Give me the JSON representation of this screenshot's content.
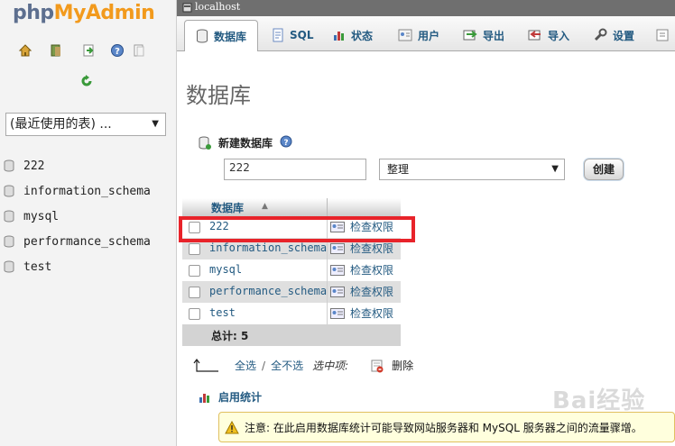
{
  "logo": {
    "part1": "php",
    "part2": "MyAdmin"
  },
  "left": {
    "recent_select": "(最近使用的表) ...",
    "databases": [
      "222",
      "information_schema",
      "mysql",
      "performance_schema",
      "test"
    ]
  },
  "topbar": {
    "host": "localhost"
  },
  "tabs": [
    {
      "label": "数据库",
      "icon": "database-icon",
      "active": true
    },
    {
      "label": "SQL",
      "icon": "sql-icon",
      "active": false
    },
    {
      "label": "状态",
      "icon": "status-icon",
      "active": false
    },
    {
      "label": "用户",
      "icon": "users-icon",
      "active": false
    },
    {
      "label": "导出",
      "icon": "export-icon",
      "active": false
    },
    {
      "label": "导入",
      "icon": "import-icon",
      "active": false
    },
    {
      "label": "设置",
      "icon": "settings-icon",
      "active": false
    }
  ],
  "main": {
    "title": "数据库",
    "create_db_label": "新建数据库",
    "db_name_value": "222",
    "collation_value": "整理",
    "create_button": "创建",
    "table": {
      "header": "数据库",
      "rows": [
        {
          "name": "222",
          "action": "检查权限"
        },
        {
          "name": "information_schema",
          "action": "检查权限"
        },
        {
          "name": "mysql",
          "action": "检查权限"
        },
        {
          "name": "performance_schema",
          "action": "检查权限"
        },
        {
          "name": "test",
          "action": "检查权限"
        }
      ],
      "total": "总计: 5"
    },
    "with_selected": {
      "check_all": "全选",
      "slash": "/",
      "uncheck_all": "全不选",
      "label": "选中项:",
      "drop": "删除"
    },
    "enable_stats": "启用统计",
    "notice": "注意: 在此启用数据库统计可能导致网站服务器和 MySQL 服务器之间的流量骤增。"
  },
  "watermark": "Bai经验",
  "colors": {
    "accent": "#235a81",
    "highlight": "#e8232a",
    "logo_gray": "#5d6f8f",
    "logo_orange": "#f29a1d"
  }
}
